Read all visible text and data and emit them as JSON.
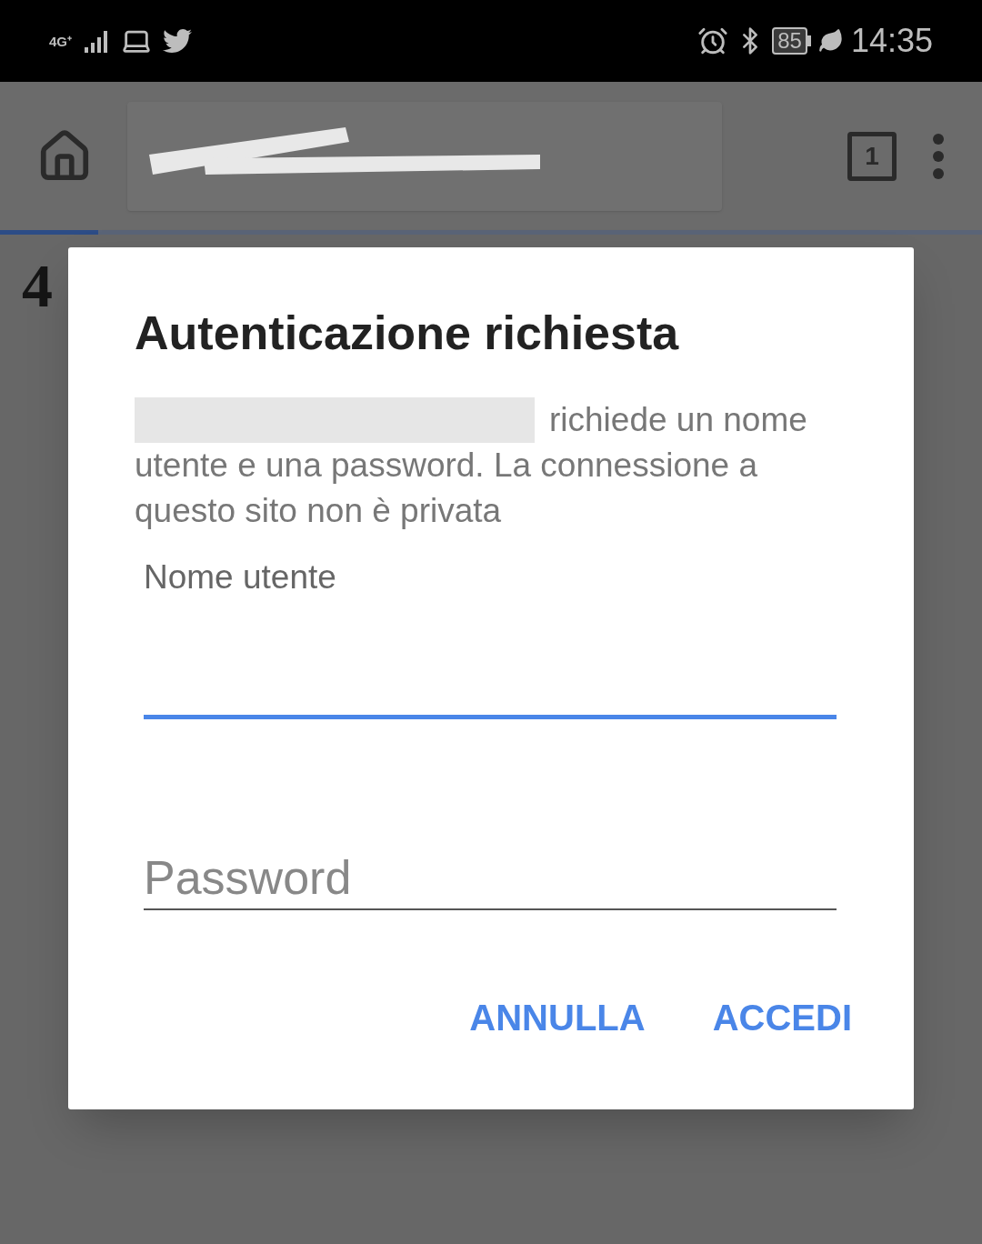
{
  "status_bar": {
    "network": "4G⁺",
    "battery": "85",
    "time": "14:35"
  },
  "toolbar": {
    "tab_count": "1"
  },
  "progress": {
    "level": 0.1
  },
  "page": {
    "heading": "4"
  },
  "dialog": {
    "title": "Autenticazione richiesta",
    "message": "richiede un nome utente e una password. La connessione a questo sito non è privata",
    "fields": [
      {
        "label": "Nome utente",
        "focused": true
      },
      {
        "placeholder": "Password",
        "focused": false
      }
    ],
    "buttons": [
      "ANNULLA",
      "ACCEDI"
    ]
  }
}
